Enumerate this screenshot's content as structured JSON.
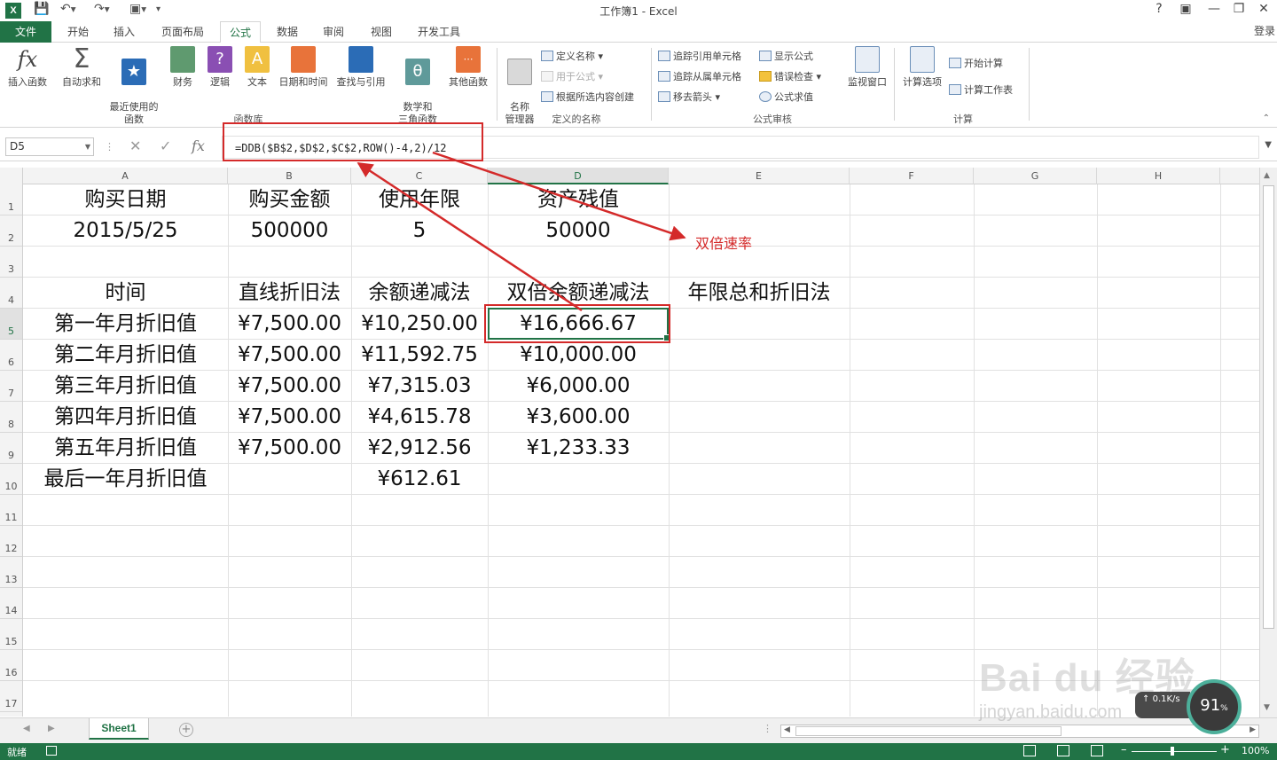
{
  "app": {
    "title": "工作簿1 - Excel",
    "login": "登录",
    "help": "?",
    "window_controls": [
      "ribbon-display-icon",
      "minimize-icon",
      "restore-icon",
      "close-icon"
    ]
  },
  "quick_access": {
    "icons": [
      "excel-logo",
      "save-icon",
      "undo-icon",
      "redo-icon",
      "touch-mode-icon",
      "customize-icon"
    ],
    "logo_text": "X"
  },
  "tabs": [
    "文件",
    "开始",
    "插入",
    "页面布局",
    "公式",
    "数据",
    "审阅",
    "视图",
    "开发工具"
  ],
  "active_tab": "公式",
  "ribbon": {
    "function_library": {
      "label": "函数库",
      "buttons": [
        "插入函数",
        "自动求和",
        "最近使用的\n函数",
        "财务",
        "逻辑",
        "文本",
        "日期和时间",
        "查找与引用",
        "数学和\n三角函数",
        "其他函数"
      ]
    },
    "defined_names": {
      "label": "定义的名称",
      "name_manager": "名称\n管理器",
      "items": [
        "定义名称",
        "用于公式",
        "根据所选内容创建"
      ]
    },
    "formula_auditing": {
      "label": "公式审核",
      "items": [
        "追踪引用单元格",
        "追踪从属单元格",
        "移去箭头",
        "显示公式",
        "错误检查",
        "公式求值"
      ],
      "watch_window": "监视窗口"
    },
    "calculation": {
      "label": "计算",
      "options": "计算选项",
      "items": [
        "开始计算",
        "计算工作表"
      ]
    },
    "colors": {
      "accent": "#217346",
      "icon_orange": "#e8733a",
      "icon_blue": "#2b6cb6",
      "icon_purple": "#8a4fb3"
    }
  },
  "formula_bar": {
    "name_box": "D5",
    "formula": "=DDB($B$2,$D$2,$C$2,ROW()-4,2)/12",
    "icons": [
      "cancel-icon",
      "enter-icon",
      "fx-icon"
    ]
  },
  "columns": [
    "A",
    "B",
    "C",
    "D",
    "E",
    "F",
    "G",
    "H"
  ],
  "selected_column": "D",
  "rows": [
    "1",
    "2",
    "3",
    "4",
    "5",
    "6",
    "7",
    "8",
    "9",
    "10",
    "11",
    "12",
    "13",
    "14",
    "15",
    "16",
    "17"
  ],
  "selected_row": "5",
  "cells": {
    "A1": "购买日期",
    "B1": "购买金额",
    "C1": "使用年限",
    "D1": "资产残值",
    "A2": "2015/5/25",
    "B2": "500000",
    "C2": "5",
    "D2": "50000",
    "A4": "时间",
    "B4": "直线折旧法",
    "C4": "余额递减法",
    "D4": "双倍余额递减法",
    "E4": "年限总和折旧法",
    "A5": "第一年月折旧值",
    "B5": "¥7,500.00",
    "C5": "¥10,250.00",
    "D5": "¥16,666.67",
    "A6": "第二年月折旧值",
    "B6": "¥7,500.00",
    "C6": "¥11,592.75",
    "D6": "¥10,000.00",
    "A7": "第三年月折旧值",
    "B7": "¥7,500.00",
    "C7": "¥7,315.03",
    "D7": "¥6,000.00",
    "A8": "第四年月折旧值",
    "B8": "¥7,500.00",
    "C8": "¥4,615.78",
    "D8": "¥3,600.00",
    "A9": "第五年月折旧值",
    "B9": "¥7,500.00",
    "C9": "¥2,912.56",
    "D9": "¥1,233.33",
    "A10": "最后一年月折旧值",
    "C10": "¥612.61"
  },
  "annotation": {
    "label": "双倍速率",
    "color": "#d42a2a"
  },
  "sheets": [
    "Sheet1"
  ],
  "active_sheet": "Sheet1",
  "status": {
    "ready": "就绪",
    "zoom": "100%"
  },
  "watermark": {
    "text": "Bai du 经验",
    "url": "jingyan.baidu.com"
  },
  "net_widget": {
    "speed": "0.1K/s",
    "percent": "91",
    "percent_sign": "%"
  }
}
